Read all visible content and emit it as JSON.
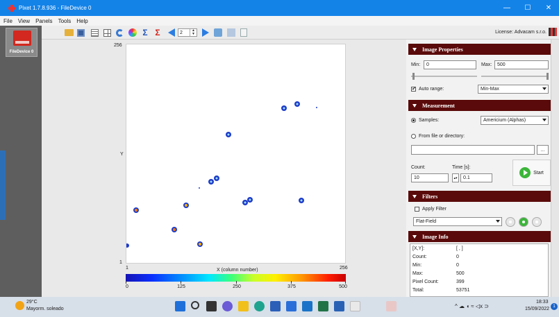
{
  "window": {
    "title": "Pixet 1.7.8.936 - FileDevice 0",
    "minimize_glyph": "—",
    "maximize_glyph": "☐",
    "close_glyph": "✕"
  },
  "menu": [
    "File",
    "View",
    "Panels",
    "Tools",
    "Help"
  ],
  "device": {
    "label": "FileDevice 0"
  },
  "toolbar": {
    "frame_value": "2",
    "license": "License: Advacam s.r.o.",
    "icons": [
      "folder-open-icon",
      "save-icon",
      "grid-icon",
      "layout-icon",
      "refresh-icon",
      "color-map-icon",
      "sum-icon",
      "sum-red-icon",
      "prev-frame-icon",
      "next-frame-icon",
      "config-icon",
      "user-icon",
      "document-icon"
    ]
  },
  "image": {
    "y_top": "256",
    "y_bottom": "1",
    "y_axis_name": "Y",
    "x_min": "1",
    "x_max": "256",
    "x_axis_name": "X (column number)",
    "colorbar_labels": [
      "0",
      "125",
      "250",
      "375",
      "500"
    ],
    "colorbar_colors": [
      "#1414b4",
      "#00a0ff",
      "#3aff7c",
      "#fff000",
      "#ff1e00"
    ]
  },
  "panels": {
    "image_properties": {
      "title": "Image Properties",
      "min_label": "Min:",
      "min_value": "0",
      "max_label": "Max:",
      "max_value": "500",
      "auto_range_label": "Auto range:",
      "auto_range_checked": "✔",
      "range_mode": "Min-Max"
    },
    "measurement": {
      "title": "Measurement",
      "samples_label": "Samples:",
      "samples_value": "Americium (Alphas)",
      "file_label": "From file or directory:",
      "browse_label": "...",
      "count_label": "Count:",
      "count_value": "10",
      "time_label": "Time [s]:",
      "time_value": "0.1",
      "start_label": "Start"
    },
    "filters": {
      "title": "Filters",
      "apply_label": "Apply Filter",
      "filter_value": "Flat-Field"
    },
    "image_info": {
      "title": "Image Info",
      "rows": [
        {
          "label": "[X,Y]:",
          "value": "[ , ]"
        },
        {
          "label": "Count:",
          "value": "0"
        },
        {
          "label": "Min:",
          "value": "0"
        },
        {
          "label": "Max:",
          "value": "500"
        },
        {
          "label": "Pixel Count:",
          "value": "399"
        },
        {
          "label": "Total:",
          "value": "53751"
        }
      ]
    }
  },
  "taskbar": {
    "temp": "29°C",
    "weather": "Mayorm. soleado",
    "tray": "^ ☁ ◖ ≈ ◁x ⊃",
    "time": "18:33",
    "date": "15/09/2022",
    "notifications": "1"
  }
}
